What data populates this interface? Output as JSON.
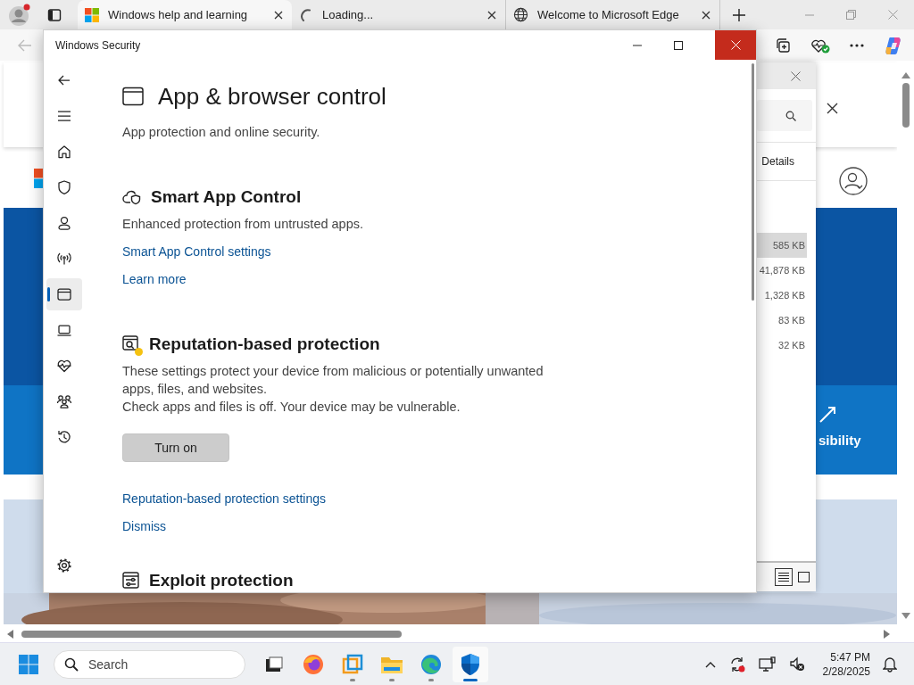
{
  "browser": {
    "tabs": [
      {
        "title": "Windows help and learning",
        "kind": "windows",
        "selected": true
      },
      {
        "title": "Loading...",
        "kind": "loading",
        "selected": false
      },
      {
        "title": "Welcome to Microsoft Edge",
        "kind": "globe",
        "selected": false
      }
    ]
  },
  "web_page": {
    "banner_text": "sibility"
  },
  "explorer": {
    "details_button": "Details",
    "sizes": [
      {
        "text": "585 KB",
        "selected": true
      },
      {
        "text": "41,878 KB",
        "selected": false
      },
      {
        "text": "1,328 KB",
        "selected": false
      },
      {
        "text": "83 KB",
        "selected": false
      },
      {
        "text": "32 KB",
        "selected": false
      }
    ],
    "views": [
      {
        "kind": "details",
        "selected": true
      },
      {
        "kind": "tiles",
        "selected": false
      }
    ]
  },
  "security": {
    "title": "Windows Security",
    "nav": [
      {
        "kind": "back",
        "selected": false
      },
      {
        "kind": "menu",
        "selected": false
      },
      {
        "kind": "home",
        "selected": false
      },
      {
        "kind": "shield",
        "selected": false
      },
      {
        "kind": "account",
        "selected": false
      },
      {
        "kind": "network",
        "selected": false
      },
      {
        "kind": "app",
        "selected": true
      },
      {
        "kind": "device",
        "selected": false
      },
      {
        "kind": "health",
        "selected": false
      },
      {
        "kind": "family",
        "selected": false
      },
      {
        "kind": "history",
        "selected": false
      },
      {
        "kind": "settings",
        "selected": false
      }
    ],
    "heading": "App & browser control",
    "subtitle": "App protection and online security.",
    "sections": [
      {
        "kind": "smart",
        "title": "Smart App Control",
        "paragraphs": [
          "Enhanced protection from untrusted apps."
        ],
        "links": [
          "Smart App Control settings",
          "Learn more"
        ]
      },
      {
        "kind": "reputation",
        "title": "Reputation-based protection",
        "warning": true,
        "paragraphs": [
          "These settings protect your device from malicious or potentially unwanted apps, files, and websites.",
          "Check apps and files is off. Your device may be vulnerable."
        ],
        "button": "Turn on",
        "links": [
          "Reputation-based protection settings",
          "Dismiss"
        ]
      },
      {
        "kind": "exploit",
        "title": "Exploit protection"
      }
    ]
  },
  "taskbar": {
    "search": {
      "placeholder": "Search"
    },
    "apps": [
      {
        "kind": "task-view",
        "running": false,
        "active": false
      },
      {
        "kind": "firefox",
        "running": false,
        "active": false
      },
      {
        "kind": "vmware",
        "running": true,
        "active": false
      },
      {
        "kind": "folder",
        "running": true,
        "active": false
      },
      {
        "kind": "edge",
        "running": true,
        "active": false
      },
      {
        "kind": "security",
        "running": true,
        "active": true
      }
    ],
    "time": "5:47 PM",
    "date": "2/28/2025"
  }
}
